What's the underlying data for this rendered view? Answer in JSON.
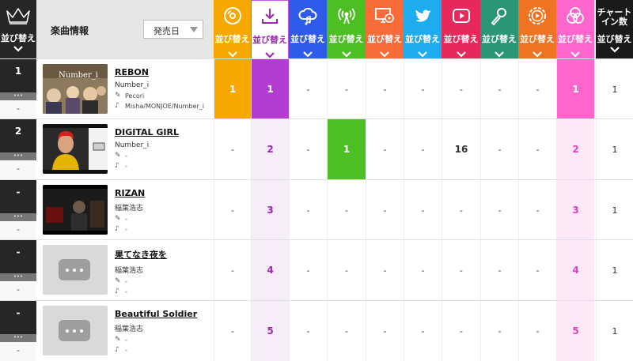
{
  "header": {
    "sort_label": "並び替え",
    "info_title": "楽曲情報",
    "sort_select": "発売日",
    "chart_in_title": "チャートイン数",
    "chart_in_line1": "チャート",
    "chart_in_line2": "イン数"
  },
  "media_columns": [
    {
      "key": "cd",
      "icon": "cd-icon",
      "color": "#f7a800"
    },
    {
      "key": "download",
      "icon": "download-icon",
      "color": "#ffffff"
    },
    {
      "key": "streaming",
      "icon": "cloud-music-icon",
      "color": "#2e5be8"
    },
    {
      "key": "radio",
      "icon": "radio-broadcast-icon",
      "color": "#4cbf22"
    },
    {
      "key": "pc-lookup",
      "icon": "computer-disc-icon",
      "color": "#f96b38"
    },
    {
      "key": "twitter",
      "icon": "twitter-bird-icon",
      "color": "#1dacef"
    },
    {
      "key": "youtube",
      "icon": "play-button-icon",
      "color": "#e8285a"
    },
    {
      "key": "karaoke",
      "icon": "microphone-icon",
      "color": "#2a9577"
    },
    {
      "key": "gyao",
      "icon": "video-play-icon",
      "color": "#ee7322"
    },
    {
      "key": "composite",
      "icon": "three-circles-icon",
      "color": "#ff66cc"
    }
  ],
  "rows": [
    {
      "rank": "1",
      "rank_dots": "•••",
      "prev": "-",
      "title": "REBON",
      "artist": "Number_i",
      "lyrics": "Pecori",
      "music": "Misha/MONJOE/Number_i",
      "thumb_text": "Number_i",
      "cells": [
        "1",
        "1",
        "-",
        "-",
        "-",
        "-",
        "-",
        "-",
        "-",
        "1"
      ],
      "chart_in": "1"
    },
    {
      "rank": "2",
      "rank_dots": "•••",
      "prev": "-",
      "title": "DIGITAL GIRL",
      "artist": "Number_i",
      "lyrics": "-",
      "music": "-",
      "cells": [
        "-",
        "2",
        "-",
        "1",
        "-",
        "-",
        "16",
        "-",
        "-",
        "2"
      ],
      "chart_in": "1"
    },
    {
      "rank": "-",
      "rank_dots": "•••",
      "prev": "-",
      "title": "RIZAN",
      "artist": "稲葉浩志",
      "lyrics": "-",
      "music": "-",
      "cells": [
        "-",
        "3",
        "-",
        "-",
        "-",
        "-",
        "-",
        "-",
        "-",
        "3"
      ],
      "chart_in": "1"
    },
    {
      "rank": "-",
      "rank_dots": "•••",
      "prev": "-",
      "title": "果てなき夜を",
      "artist": "稲葉浩志",
      "lyrics": "-",
      "music": "-",
      "cells": [
        "-",
        "4",
        "-",
        "-",
        "-",
        "-",
        "-",
        "-",
        "-",
        "4"
      ],
      "chart_in": "1"
    },
    {
      "rank": "-",
      "rank_dots": "•••",
      "prev": "-",
      "title": "Beautiful Soldier",
      "artist": "稲葉浩志",
      "lyrics": "-",
      "music": "-",
      "cells": [
        "-",
        "5",
        "-",
        "-",
        "-",
        "-",
        "-",
        "-",
        "-",
        "5"
      ],
      "chart_in": "1"
    }
  ]
}
